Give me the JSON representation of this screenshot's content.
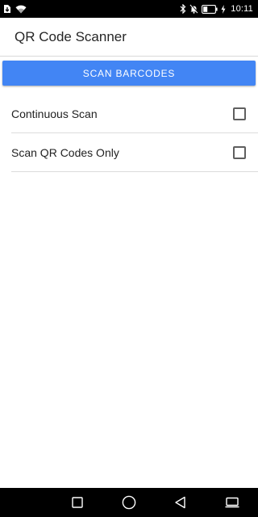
{
  "status_bar": {
    "time": "10:11",
    "icons": [
      "download-notification-icon",
      "wifi-icon",
      "bluetooth-icon",
      "mute-icon",
      "battery-icon",
      "charging-icon"
    ]
  },
  "app_bar": {
    "title": "QR Code Scanner"
  },
  "scan_button": {
    "label": "Scan Barcodes",
    "color": "#4285f4"
  },
  "options": [
    {
      "label": "Continuous Scan",
      "checked": false
    },
    {
      "label": "Scan QR Codes Only",
      "checked": false
    }
  ],
  "nav_bar": {
    "buttons": [
      "recents-square-icon",
      "home-circle-icon",
      "back-triangle-icon",
      "screen-cast-icon"
    ]
  }
}
